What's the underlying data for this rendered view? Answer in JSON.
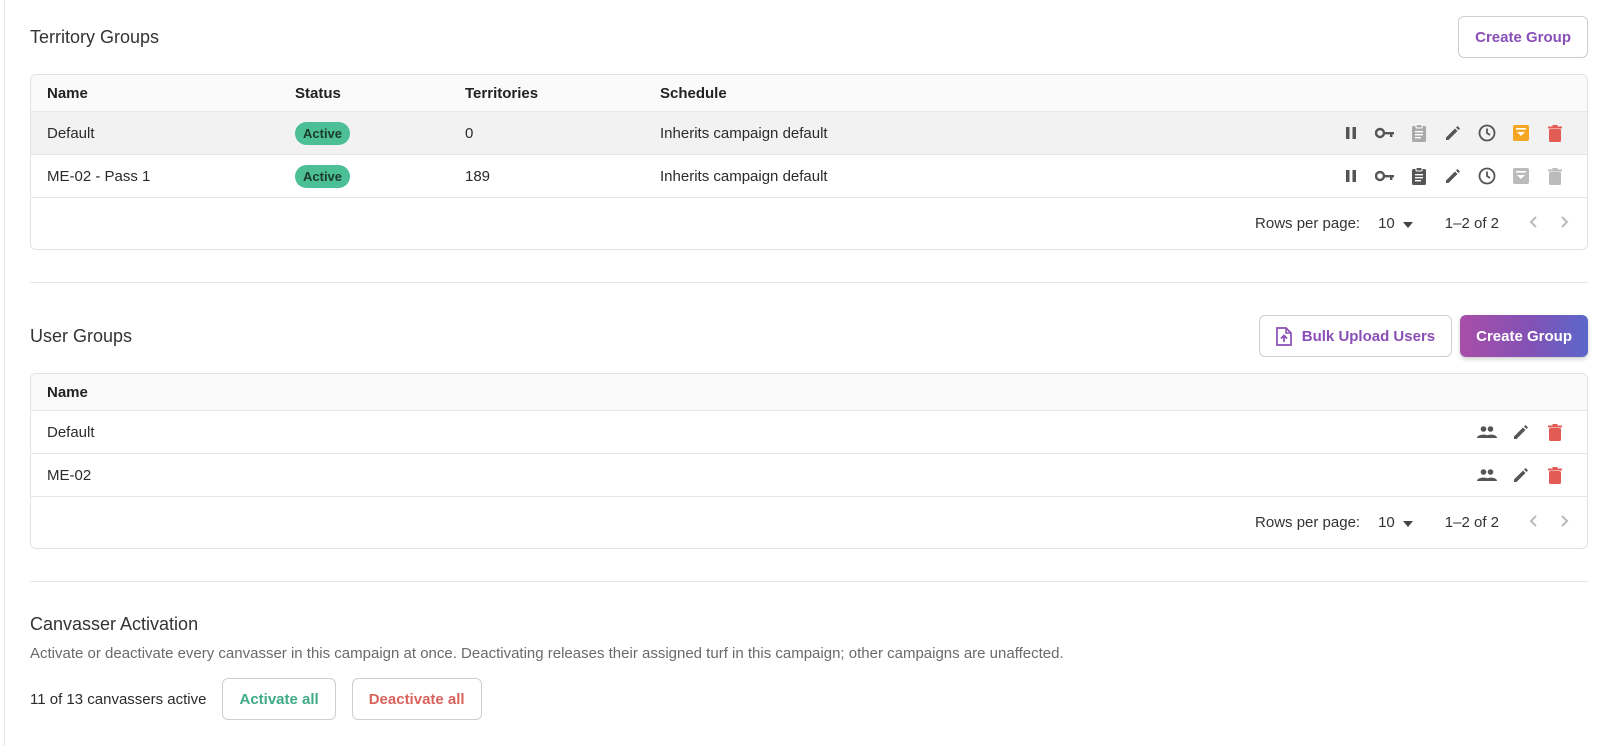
{
  "colors": {
    "accent": "#8a4fb6",
    "active_badge": "#4cbf97",
    "danger": "#e25c55",
    "warning": "#f5a623",
    "activate_text": "#3faa86",
    "deactivate_text": "#d9635c"
  },
  "territory_groups": {
    "title": "Territory Groups",
    "create_label": "Create Group",
    "columns": [
      "Name",
      "Status",
      "Territories",
      "Schedule"
    ],
    "rows": [
      {
        "name": "Default",
        "status": "Active",
        "territories": "0",
        "schedule": "Inherits campaign default",
        "icons": [
          "pause-icon",
          "key-icon",
          "clipboard-icon",
          "edit-icon",
          "clock-icon",
          "archive-icon",
          "delete-icon"
        ]
      },
      {
        "name": "ME-02 - Pass 1",
        "status": "Active",
        "territories": "189",
        "schedule": "Inherits campaign default",
        "icons": [
          "pause-icon",
          "key-icon",
          "clipboard-icon",
          "edit-icon",
          "clock-icon",
          "archive-icon",
          "delete-icon"
        ]
      }
    ],
    "pagination": {
      "rows_per_page_label": "Rows per page:",
      "rows_per_page_value": "10",
      "range": "1–2 of 2"
    }
  },
  "user_groups": {
    "title": "User Groups",
    "bulk_upload_label": "Bulk Upload Users",
    "create_label": "Create Group",
    "columns": [
      "Name"
    ],
    "rows": [
      {
        "name": "Default",
        "icons": [
          "people-icon",
          "edit-icon",
          "delete-icon"
        ]
      },
      {
        "name": "ME-02",
        "icons": [
          "people-icon",
          "edit-icon",
          "delete-icon"
        ]
      }
    ],
    "pagination": {
      "rows_per_page_label": "Rows per page:",
      "rows_per_page_value": "10",
      "range": "1–2 of 2"
    }
  },
  "canvasser_activation": {
    "title": "Canvasser Activation",
    "description": "Activate or deactivate every canvasser in this campaign at once. Deactivating releases their assigned turf in this campaign; other campaigns are unaffected.",
    "count_text": "11 of 13 canvassers active",
    "activate_label": "Activate all",
    "deactivate_label": "Deactivate all"
  }
}
